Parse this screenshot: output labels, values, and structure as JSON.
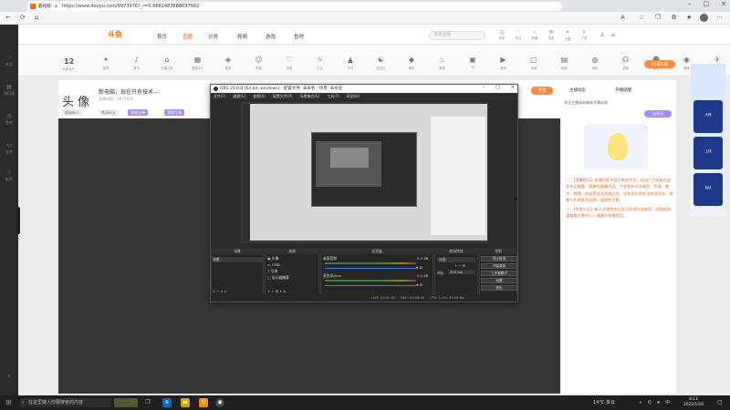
{
  "browser": {
    "tab_title": "最纯粹最强播的直播_无限制的吃",
    "url": "https://www.douyu.com/9973976?_r=0.6681487868637992"
  },
  "site": {
    "logo": "斗鱼",
    "nav": [
      "首页",
      "直播",
      "分类",
      "视频",
      "游戏",
      "鱼吧"
    ],
    "search_placeholder": "搜索主播",
    "header_icons": [
      {
        "icon": "history-icon",
        "label": "历史"
      },
      {
        "icon": "follow-icon",
        "label": "关注"
      },
      {
        "icon": "favorite-icon",
        "label": "收藏"
      },
      {
        "icon": "message-icon",
        "label": "消息"
      },
      {
        "icon": "location-icon",
        "label": "位置"
      },
      {
        "icon": "download-icon",
        "label": "下载"
      }
    ],
    "sidebar": [
      "关注",
      "排行榜",
      "鱼吧",
      "文库",
      "推荐"
    ],
    "hot_count": "12",
    "hot_label": "分钟",
    "hot_label2": "大厅",
    "categories": [
      "星秀",
      "音乐",
      "主播之家",
      "直播大厅",
      "赛事",
      "颜值",
      "情感",
      "生活",
      "户外",
      "交友派",
      "兼技",
      "美食",
      "3D",
      "游戏",
      "手游",
      "网游",
      "单机",
      "语音",
      "娱乐",
      "健身",
      "军事"
    ],
    "pc_button": "PC端下载"
  },
  "room": {
    "title_main": "头 像",
    "title_text": "新电脑，现在只有技术---",
    "sub": "直播间ID：9973976",
    "tags": [
      "超级新人",
      "邀请好友",
      "荣誉主播"
    ],
    "follow_button": "关注"
  },
  "right_panel": {
    "tabs": [
      "主播动态",
      "开播提醒"
    ],
    "info": "关注主播获取最新开播动态",
    "button": "去关注",
    "notice": [
      "【温馨提示】直播内容平台已审核完毕，欢迎广大网友在此发布正能量、健康的直播内容，严禁发布涉及政治、色情、暴力、赌博、低俗等违法违规信息，如有违反将依法依规处理，弹幕与礼物皆为自愿，请理性消费。",
      "【系统公告】新人主播完成任务可获得平台推荐，详细规则请查看主播中心，请遵守直播规范。"
    ]
  },
  "ads": [
    "大神",
    "上线",
    "玩法"
  ],
  "obs": {
    "title": "OBS 25.0.8 (64 bit, windows) - 配置文件: 未命名 - 场景: 未命名",
    "menu": [
      "文件(F)",
      "编辑(E)",
      "查看(V)",
      "配置文件(P)",
      "场景集合(S)",
      "工具(T)",
      "帮助(H)"
    ],
    "docks": {
      "scenes": "场景",
      "sources": "来源",
      "mixer": "混音器",
      "transitions": "转场特效",
      "controls": "控制"
    },
    "scene_items": [
      "场景"
    ],
    "source_items": [
      "头像",
      "CMD",
      "引流",
      "显示器捕获"
    ],
    "mixer_items": [
      {
        "name": "桌面音频",
        "db": "0.0 dB"
      },
      {
        "name": "麦克风/Aux",
        "db": "0.0 dB"
      }
    ],
    "transition": {
      "mode": "淡出",
      "duration_label": "时长",
      "duration": "300 ms"
    },
    "controls": [
      "停止推流",
      "开始录制",
      "工作室模式",
      "设置",
      "退出"
    ],
    "status": [
      "LIVE: 00:00:00",
      "REC: 00:00:00",
      "CPU: 1.3%, 30.00 fps"
    ]
  },
  "taskbar": {
    "search": "在这里输入你要搜索的内容",
    "weather": "14°C 多云",
    "time": "8:11",
    "date": "2022/10/8"
  }
}
